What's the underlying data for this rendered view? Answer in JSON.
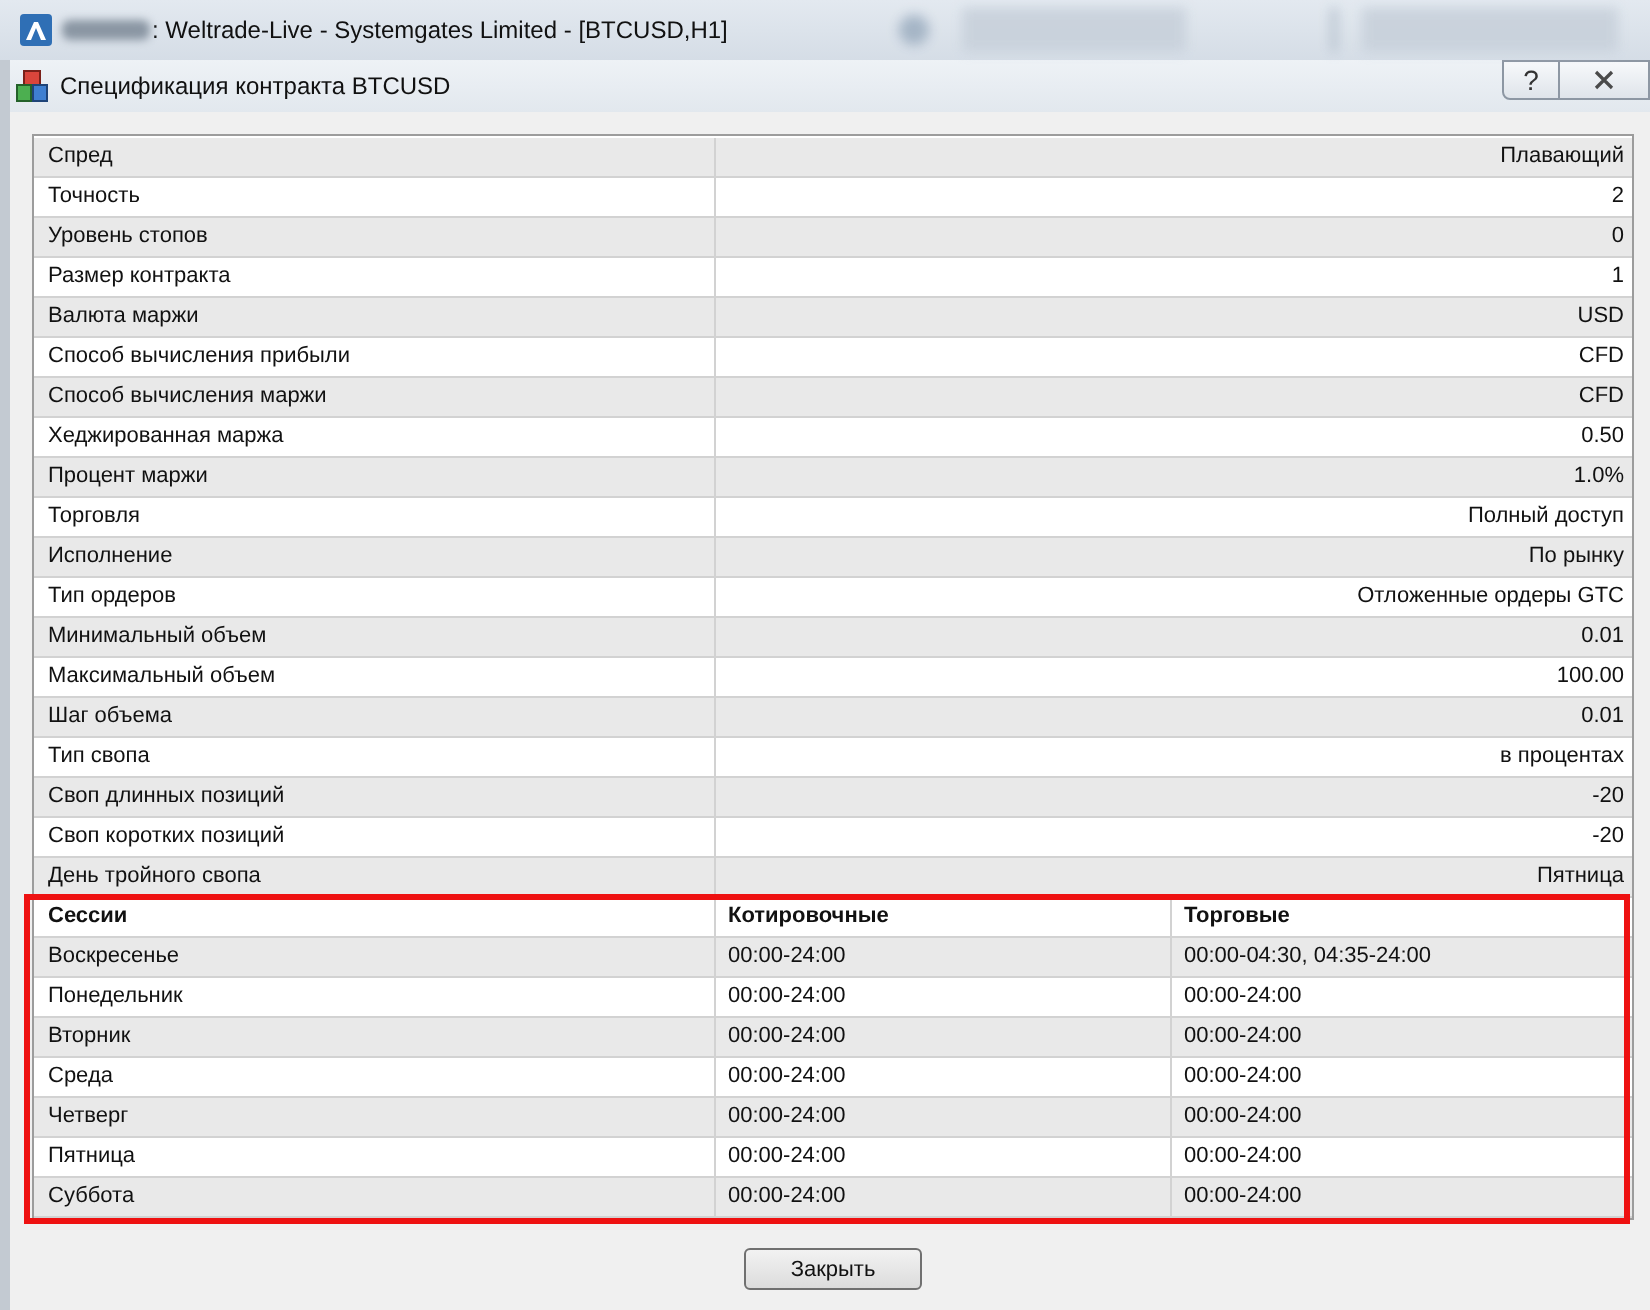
{
  "main_window": {
    "title": ": Weltrade-Live - Systemgates Limited - [BTCUSD,H1]"
  },
  "dialog": {
    "title": "Спецификация контракта BTCUSD",
    "help_button": "?"
  },
  "specs": [
    {
      "name": "Спред",
      "value": "Плавающий"
    },
    {
      "name": "Точность",
      "value": "2"
    },
    {
      "name": "Уровень стопов",
      "value": "0"
    },
    {
      "name": "Размер контракта",
      "value": "1"
    },
    {
      "name": "Валюта маржи",
      "value": "USD"
    },
    {
      "name": "Способ вычисления прибыли",
      "value": "CFD"
    },
    {
      "name": "Способ вычисления маржи",
      "value": "CFD"
    },
    {
      "name": "Хеджированная маржа",
      "value": "0.50"
    },
    {
      "name": "Процент маржи",
      "value": "1.0%"
    },
    {
      "name": "Торговля",
      "value": "Полный доступ"
    },
    {
      "name": "Исполнение",
      "value": "По рынку"
    },
    {
      "name": "Тип ордеров",
      "value": "Отложенные ордеры GTC"
    },
    {
      "name": "Минимальный объем",
      "value": "0.01"
    },
    {
      "name": "Максимальный объем",
      "value": "100.00"
    },
    {
      "name": "Шаг объема",
      "value": "0.01"
    },
    {
      "name": "Тип свопа",
      "value": "в процентах"
    },
    {
      "name": "Своп длинных позиций",
      "value": "-20"
    },
    {
      "name": "Своп коротких позиций",
      "value": "-20"
    },
    {
      "name": "День тройного свопа",
      "value": "Пятница"
    }
  ],
  "sessions": {
    "highlighted": true,
    "columns": [
      "Сессии",
      "Котировочные",
      "Торговые"
    ],
    "rows": [
      [
        "Воскресенье",
        "00:00-24:00",
        "00:00-04:30, 04:35-24:00"
      ],
      [
        "Понедельник",
        "00:00-24:00",
        "00:00-24:00"
      ],
      [
        "Вторник",
        "00:00-24:00",
        "00:00-24:00"
      ],
      [
        "Среда",
        "00:00-24:00",
        "00:00-24:00"
      ],
      [
        "Четверг",
        "00:00-24:00",
        "00:00-24:00"
      ],
      [
        "Пятница",
        "00:00-24:00",
        "00:00-24:00"
      ],
      [
        "Суббота",
        "00:00-24:00",
        "00:00-24:00"
      ]
    ]
  },
  "buttons": [
    "Закрыть"
  ]
}
